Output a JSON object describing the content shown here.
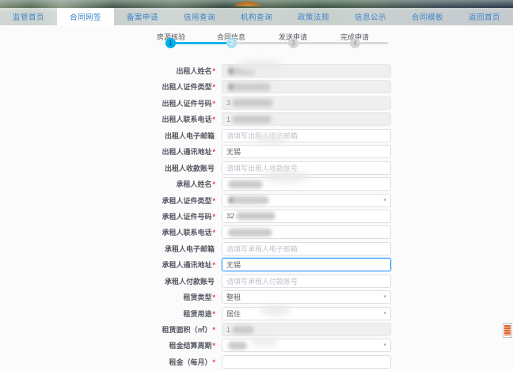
{
  "nav": {
    "items": [
      {
        "label": "监管首页",
        "active": false
      },
      {
        "label": "合同网签",
        "active": true
      },
      {
        "label": "备案申请",
        "active": false
      },
      {
        "label": "信用查询",
        "active": false
      },
      {
        "label": "机构查询",
        "active": false
      },
      {
        "label": "政策法规",
        "active": false
      },
      {
        "label": "信息公示",
        "active": false
      },
      {
        "label": "合同模板",
        "active": false
      },
      {
        "label": "返回首页",
        "active": false
      }
    ]
  },
  "steps": {
    "items": [
      {
        "num": "1",
        "label": "房源核验",
        "state": "done"
      },
      {
        "num": "2",
        "label": "合同信息",
        "state": "current"
      },
      {
        "num": "3",
        "label": "发送申请",
        "state": "pending"
      },
      {
        "num": "4",
        "label": "完成申请",
        "state": "pending"
      }
    ]
  },
  "form": {
    "rows": [
      {
        "label": "出租人姓名",
        "mark": "*",
        "control": "input",
        "state": "disabled",
        "value": "",
        "prefix": "",
        "placeholder": "",
        "redacted": true
      },
      {
        "label": "出租人证件类型",
        "mark": "*",
        "control": "input",
        "state": "disabled",
        "value": "",
        "prefix": "",
        "placeholder": "",
        "redacted": true
      },
      {
        "label": "出租人证件号码",
        "mark": "*",
        "control": "input",
        "state": "disabled",
        "value": "",
        "prefix": "3",
        "placeholder": "",
        "redacted": true
      },
      {
        "label": "出租人联系电话",
        "mark": "*",
        "control": "input",
        "state": "disabled",
        "value": "",
        "prefix": "1",
        "placeholder": "",
        "redacted": true
      },
      {
        "label": "出租人电子邮箱",
        "mark": "",
        "control": "input",
        "state": "normal",
        "value": "",
        "prefix": "",
        "placeholder": "请填写出租人电子邮箱",
        "redacted": false
      },
      {
        "label": "出租人通讯地址",
        "mark": "*",
        "control": "input",
        "state": "normal",
        "value": "无锡",
        "prefix": "",
        "placeholder": "",
        "redacted": false
      },
      {
        "label": "出租人收款账号",
        "mark": "",
        "control": "input",
        "state": "normal",
        "value": "",
        "prefix": "",
        "placeholder": "请填写出租人收款账号",
        "redacted": false
      },
      {
        "label": "承租人姓名",
        "mark": "*",
        "control": "input",
        "state": "normal",
        "value": "",
        "prefix": "",
        "placeholder": "",
        "redacted": true
      },
      {
        "label": "承租人证件类型",
        "mark": "*",
        "control": "select",
        "state": "normal",
        "value": "",
        "prefix": "",
        "placeholder": "",
        "redacted": true
      },
      {
        "label": "承租人证件号码",
        "mark": "*",
        "control": "input",
        "state": "normal",
        "value": "",
        "prefix": "32",
        "placeholder": "",
        "redacted": true
      },
      {
        "label": "承租人联系电话",
        "mark": "*",
        "control": "input",
        "state": "normal",
        "value": "",
        "prefix": "",
        "placeholder": "",
        "redacted": true
      },
      {
        "label": "承租人电子邮箱",
        "mark": "",
        "control": "input",
        "state": "normal",
        "value": "",
        "prefix": "",
        "placeholder": "请填写承租人电子邮箱",
        "redacted": false
      },
      {
        "label": "承租人通讯地址",
        "mark": "*",
        "control": "input",
        "state": "focused",
        "value": "无锡",
        "prefix": "",
        "placeholder": "",
        "redacted": false
      },
      {
        "label": "承租人付款账号",
        "mark": "",
        "control": "input",
        "state": "normal",
        "value": "",
        "prefix": "",
        "placeholder": "请填写承租人付款账号",
        "redacted": false
      },
      {
        "label": "租赁类型",
        "mark": "*",
        "control": "select",
        "state": "normal",
        "value": "整租",
        "prefix": "",
        "placeholder": "",
        "redacted": false
      },
      {
        "label": "租赁用途",
        "mark": "*",
        "control": "select",
        "state": "normal",
        "value": "居住",
        "prefix": "",
        "placeholder": "",
        "redacted": false
      },
      {
        "label": "租赁面积（㎡）",
        "mark": "*",
        "control": "input",
        "state": "disabled",
        "value": "",
        "prefix": "1",
        "placeholder": "",
        "redacted": true
      },
      {
        "label": "租金结算周期",
        "mark": "*",
        "control": "select",
        "state": "normal",
        "value": "",
        "prefix": "",
        "placeholder": "",
        "redacted": true
      },
      {
        "label": "租金（每月）",
        "mark": "*",
        "control": "input",
        "state": "normal",
        "value": "",
        "prefix": "",
        "placeholder": "",
        "redacted": false
      }
    ]
  },
  "colors": {
    "accent_blue": "#00aee8",
    "nav_blue": "#3e83c9",
    "focus_blue": "#409eff",
    "required_red": "#f23c3c",
    "step_inactive": "#d6d6d6",
    "widget_orange": "#e0622d"
  }
}
